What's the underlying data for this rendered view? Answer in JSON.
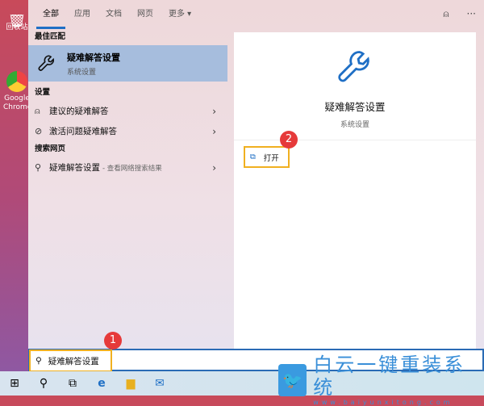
{
  "desktop": {
    "icons": [
      {
        "label": "回收站"
      },
      {
        "label": "Google Chrome"
      }
    ]
  },
  "tabs": [
    {
      "label": "全部",
      "active": true
    },
    {
      "label": "应用"
    },
    {
      "label": "文档"
    },
    {
      "label": "网页"
    },
    {
      "label": "更多 ▾"
    }
  ],
  "top_icons": [
    "feedback-icon",
    "more-icon"
  ],
  "left": {
    "best_match_header": "最佳匹配",
    "best_match": {
      "title": "疑难解答设置",
      "subtitle": "系统设置",
      "icon": "wrench-icon"
    },
    "settings_header": "设置",
    "settings": [
      {
        "label": "建议的疑难解答",
        "icon": "person-feedback-icon"
      },
      {
        "label": "激活问题疑难解答",
        "icon": "check-circle-icon"
      }
    ],
    "web_header": "搜索网页",
    "web": {
      "label": "疑难解答设置",
      "sub": "- 查看网络搜索结果",
      "icon": "search-icon"
    }
  },
  "right": {
    "title": "疑难解答设置",
    "subtitle": "系统设置",
    "open_label": "打开"
  },
  "badges": [
    "1",
    "2"
  ],
  "search": {
    "value": "疑难解答设置"
  },
  "watermark": {
    "cn": "白云一键重装系统",
    "en": "www.baiyunxitong.com"
  },
  "colors": {
    "accent": "#1f6fc5",
    "highlight": "#f0b020",
    "badge": "#e63a3a",
    "selection": "#a6bddd"
  }
}
